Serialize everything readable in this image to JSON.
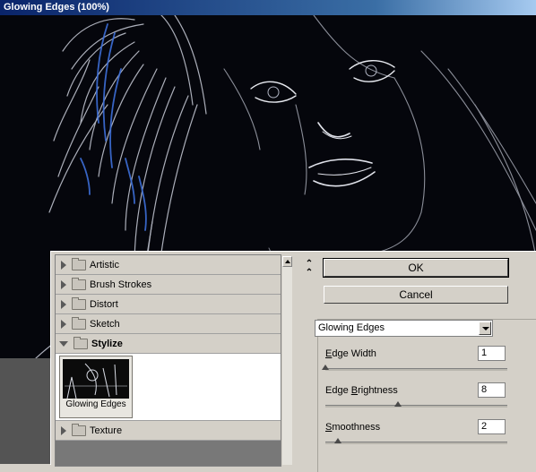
{
  "window": {
    "title": "Glowing Edges (100%)"
  },
  "gallery": {
    "categories": [
      {
        "label": "Artistic",
        "expanded": false
      },
      {
        "label": "Brush Strokes",
        "expanded": false
      },
      {
        "label": "Distort",
        "expanded": false
      },
      {
        "label": "Sketch",
        "expanded": false
      },
      {
        "label": "Stylize",
        "expanded": true
      },
      {
        "label": "Texture",
        "expanded": false
      }
    ],
    "selected_filter": "Glowing Edges"
  },
  "settings": {
    "ok_label": "OK",
    "cancel_label": "Cancel",
    "filter_select": "Glowing Edges",
    "params": [
      {
        "label_pre": "",
        "label_mnemonic": "E",
        "label_post": "dge Width",
        "value": "1",
        "slider_fraction": 0.0
      },
      {
        "label_pre": "Edge ",
        "label_mnemonic": "B",
        "label_post": "rightness",
        "value": "8",
        "slider_fraction": 0.4
      },
      {
        "label_pre": "",
        "label_mnemonic": "S",
        "label_post": "moothness",
        "value": "2",
        "slider_fraction": 0.07
      }
    ]
  },
  "colors": {
    "titlebar": "#0a246a",
    "preview_bg": "#05060c",
    "edge_glow_blue": "#3d6fd8",
    "dialog_face": "#d4d0c8"
  },
  "icons": {
    "expand": "triangle-right-icon",
    "collapse_panel": "double-chevron-up-icon",
    "folder": "folder-icon"
  }
}
